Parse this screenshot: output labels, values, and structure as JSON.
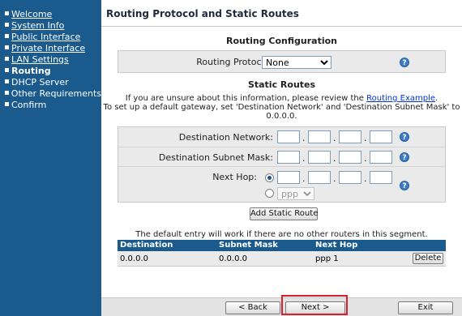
{
  "sidebar": {
    "items": [
      {
        "label": "Welcome"
      },
      {
        "label": "System Info"
      },
      {
        "label": "Public Interface"
      },
      {
        "label": "Private Interface"
      },
      {
        "label": "LAN Settings"
      },
      {
        "label": "Routing"
      },
      {
        "label": "DHCP Server"
      },
      {
        "label": "Other Requirements"
      },
      {
        "label": "Confirm"
      }
    ],
    "active_index": 5
  },
  "header": {
    "title": "Routing Protocol and Static Routes"
  },
  "routing_config": {
    "title": "Routing Configuration",
    "protocol_label": "Routing Protocol:",
    "protocol_value": "None"
  },
  "static_routes": {
    "title": "Static Routes",
    "info_line1_prefix": "If you are unsure about this information, please review the ",
    "info_link": "Routing Example",
    "info_line1_suffix": ".",
    "info_line2": "To set up a default gateway, set 'Destination Network' and 'Destination Subnet Mask' to",
    "info_line3": "0.0.0.0.",
    "dest_network_label": "Destination Network:",
    "dest_mask_label": "Destination Subnet Mask:",
    "next_hop_label": "Next Hop:",
    "interface_value": "ppp 1",
    "add_button": "Add Static Route"
  },
  "routes_table": {
    "note": "The default entry will work if there are no other routers in this segment.",
    "columns": [
      "Destination",
      "Subnet Mask",
      "Next Hop"
    ],
    "rows": [
      {
        "destination": "0.0.0.0",
        "subnet_mask": "0.0.0.0",
        "next_hop": "ppp 1",
        "action": "Delete"
      }
    ]
  },
  "footer": {
    "back_label": "< Back",
    "next_label": "Next >",
    "exit_label": "Exit"
  },
  "colors": {
    "sidebar_bg": "#1a5a8c",
    "panel_bg": "#eaeaea",
    "highlight": "#d4202c",
    "help_icon": "#3d7cc7"
  },
  "icons": {
    "help": "question-mark-circle",
    "dropdown": "chevron-down",
    "nav_bullet": "square-bullet"
  }
}
